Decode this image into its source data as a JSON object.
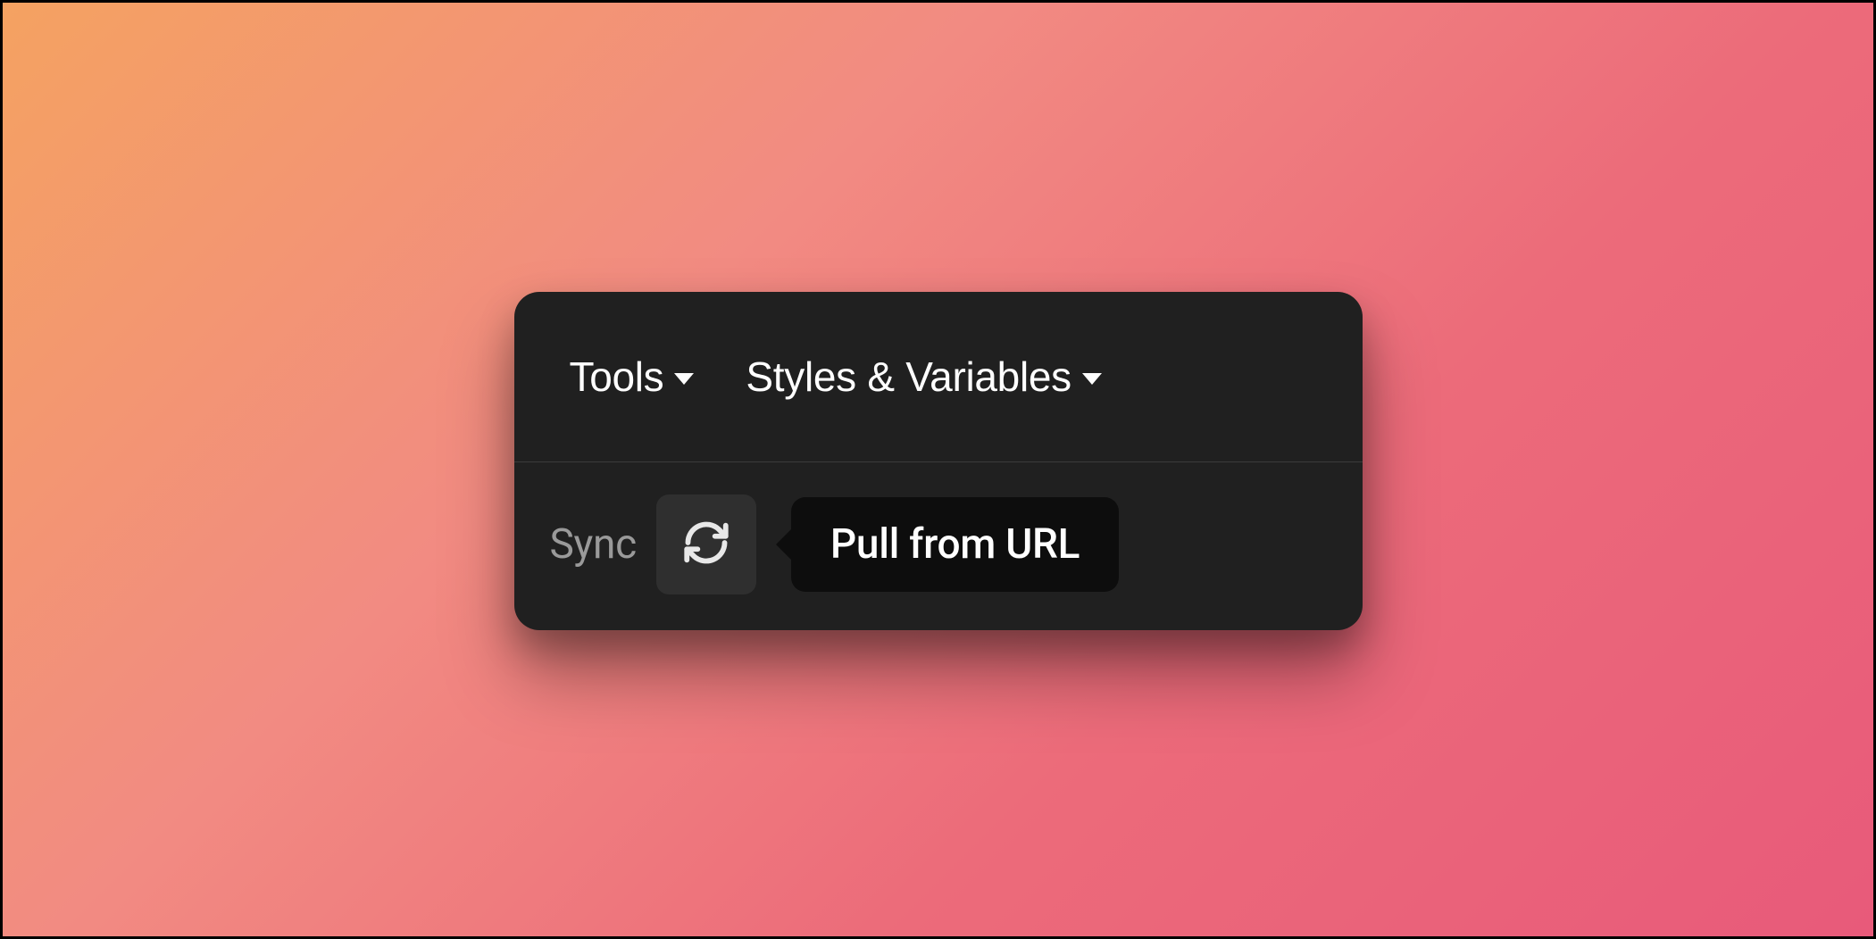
{
  "toolbar": {
    "tools_label": "Tools",
    "styles_label": "Styles & Variables"
  },
  "sync": {
    "label": "Sync",
    "tooltip": "Pull from URL"
  }
}
